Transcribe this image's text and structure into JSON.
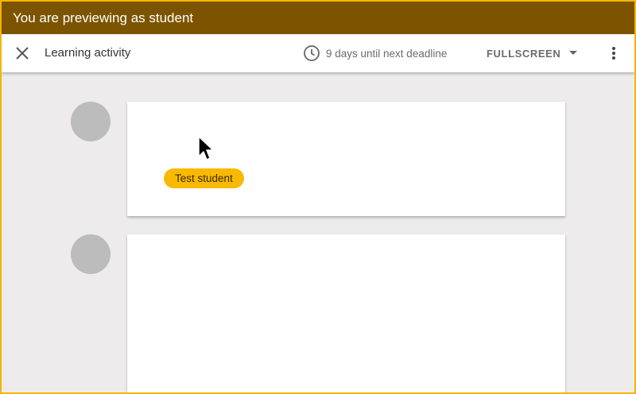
{
  "banner": {
    "text": "You are previewing as student"
  },
  "toolbar": {
    "title": "Learning activity",
    "deadline": "9 days until next deadline",
    "fullscreen_label": "FULLSCREEN",
    "icons": {
      "close": "close-icon",
      "clock": "clock-icon",
      "dropdown": "chevron-down-icon",
      "more": "more-vert-icon"
    }
  },
  "cards": [
    {
      "chip": "Test student"
    },
    {
      "chip": ""
    }
  ],
  "colors": {
    "banner_bg": "#7c5400",
    "frame_border": "#f5b400",
    "chip_bg": "#f9b900",
    "page_bg": "#edebec"
  }
}
